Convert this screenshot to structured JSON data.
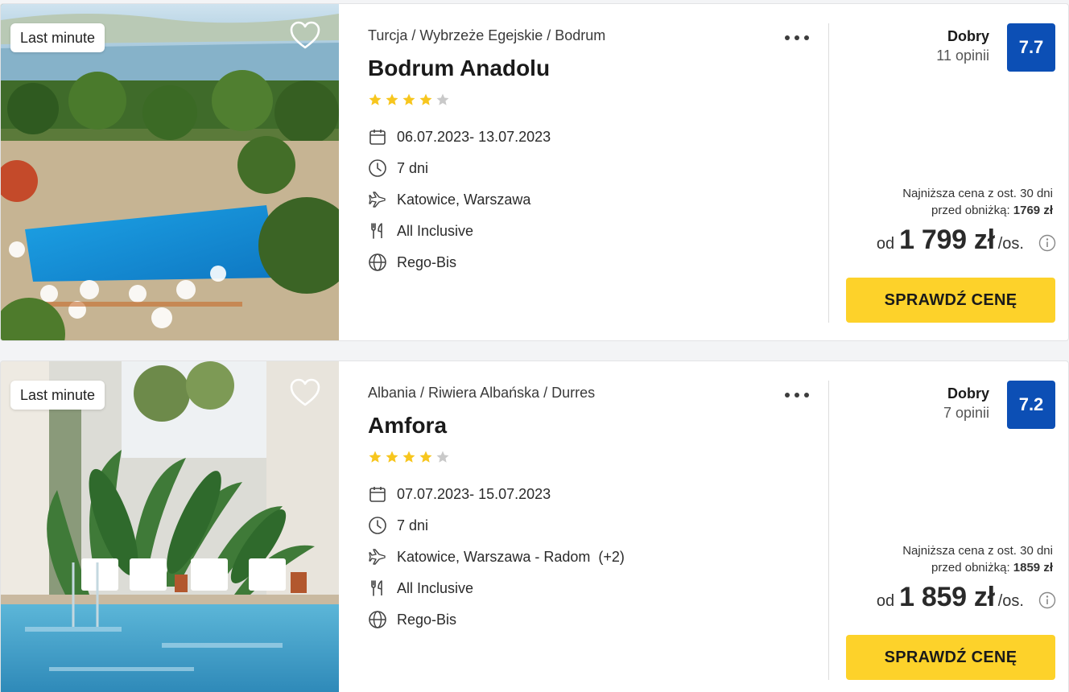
{
  "offers": [
    {
      "badge": "Last minute",
      "breadcrumb": "Turcja / Wybrzeże Egejskie / Bodrum",
      "hotel_name": "Bodrum Anadolu",
      "stars": 4,
      "dates": "06.07.2023- 13.07.2023",
      "duration": "7 dni",
      "departure": "Katowice, Warszawa",
      "board": "All Inclusive",
      "operator": "Rego-Bis",
      "rating_label": "Dobry",
      "reviews": "11 opinii",
      "score": "7.7",
      "lowest_price_text_1": "Najniższa cena z ost. 30 dni",
      "lowest_price_text_2": "przed obniżką:",
      "lowest_price_value": "1769 zł",
      "price_prefix": "od",
      "price": "1 799 zł",
      "price_suffix": "/os.",
      "cta": "SPRAWDŹ CENĘ"
    },
    {
      "badge": "Last minute",
      "breadcrumb": "Albania / Riwiera Albańska / Durres",
      "hotel_name": "Amfora",
      "stars": 4,
      "dates": "07.07.2023- 15.07.2023",
      "duration": "7 dni",
      "departure": "Katowice, Warszawa - Radom  (+2)",
      "board": "All Inclusive",
      "operator": "Rego-Bis",
      "rating_label": "Dobry",
      "reviews": "7 opinii",
      "score": "7.2",
      "lowest_price_text_1": "Najniższa cena z ost. 30 dni",
      "lowest_price_text_2": "przed obniżką:",
      "lowest_price_value": "1859 zł",
      "price_prefix": "od",
      "price": "1 859 zł",
      "price_suffix": "/os.",
      "cta": "SPRAWDŹ CENĘ"
    }
  ],
  "icons": {
    "heart": "heart-outline-icon",
    "more": "more-dots-icon",
    "calendar": "calendar-icon",
    "clock": "clock-icon",
    "plane": "plane-icon",
    "board": "cutlery-icon",
    "operator": "globe-icon",
    "info": "info-icon"
  },
  "colors": {
    "score_bg": "#0c4fb5",
    "cta_bg": "#fdd22a",
    "star_filled": "#f7c61e",
    "star_empty": "#c9c9c9"
  }
}
